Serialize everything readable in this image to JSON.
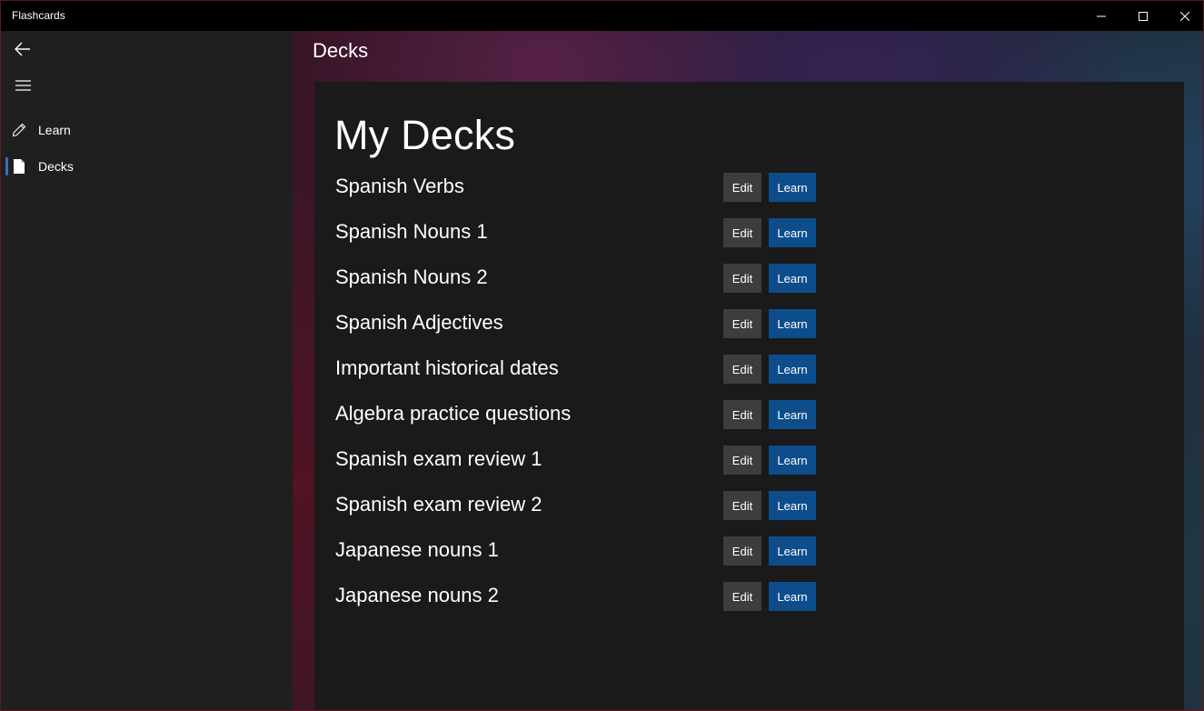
{
  "app": {
    "title": "Flashcards"
  },
  "sidebar": {
    "items": [
      {
        "label": "Learn",
        "icon": "pencil-icon"
      },
      {
        "label": "Decks",
        "icon": "document-icon"
      }
    ]
  },
  "header": {
    "title": "Decks"
  },
  "main": {
    "title": "My Decks",
    "decks": [
      {
        "name": "Spanish Verbs",
        "edit_label": "Edit",
        "learn_label": "Learn"
      },
      {
        "name": "Spanish Nouns 1",
        "edit_label": "Edit",
        "learn_label": "Learn"
      },
      {
        "name": "Spanish Nouns 2",
        "edit_label": "Edit",
        "learn_label": "Learn"
      },
      {
        "name": "Spanish Adjectives",
        "edit_label": "Edit",
        "learn_label": "Learn"
      },
      {
        "name": "Important historical dates",
        "edit_label": "Edit",
        "learn_label": "Learn"
      },
      {
        "name": "Algebra practice questions",
        "edit_label": "Edit",
        "learn_label": "Learn"
      },
      {
        "name": "Spanish exam review 1",
        "edit_label": "Edit",
        "learn_label": "Learn"
      },
      {
        "name": "Spanish exam review 2",
        "edit_label": "Edit",
        "learn_label": "Learn"
      },
      {
        "name": "Japanese nouns 1",
        "edit_label": "Edit",
        "learn_label": "Learn"
      },
      {
        "name": "Japanese nouns 2",
        "edit_label": "Edit",
        "learn_label": "Learn"
      }
    ]
  },
  "colors": {
    "accent": "#0d4d8c",
    "edit_button": "#3d3d3d",
    "selection": "#3c6fb4"
  }
}
